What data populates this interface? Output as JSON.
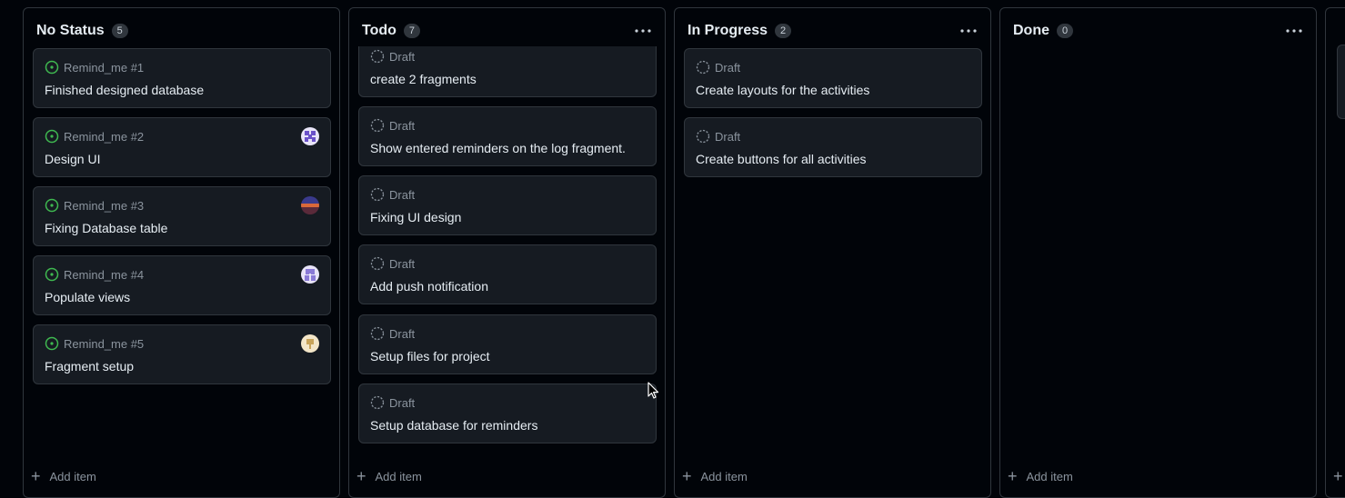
{
  "columns": [
    {
      "title": "No Status",
      "count": "5",
      "add_label": "Add item",
      "cards": [
        {
          "meta": "Remind_me #1",
          "title": "Finished designed database",
          "status_icon": "open-issue-icon",
          "avatar": null
        },
        {
          "meta": "Remind_me #2",
          "title": "Design UI",
          "status_icon": "open-issue-icon",
          "avatar": "identicon-purple"
        },
        {
          "meta": "Remind_me #3",
          "title": "Fixing Database table",
          "status_icon": "open-issue-icon",
          "avatar": "sunset-photo"
        },
        {
          "meta": "Remind_me #4",
          "title": "Populate views",
          "status_icon": "open-issue-icon",
          "avatar": "identicon-lavender"
        },
        {
          "meta": "Remind_me #5",
          "title": "Fragment setup",
          "status_icon": "open-issue-icon",
          "avatar": "identicon-tan"
        }
      ]
    },
    {
      "title": "Todo",
      "count": "7",
      "add_label": "Add item",
      "cards": [
        {
          "meta": "Draft",
          "title": "create 2 fragments",
          "status_icon": "draft-icon"
        },
        {
          "meta": "Draft",
          "title": "Show entered reminders on the log fragment.",
          "status_icon": "draft-icon"
        },
        {
          "meta": "Draft",
          "title": "Fixing UI design",
          "status_icon": "draft-icon"
        },
        {
          "meta": "Draft",
          "title": "Add push notification",
          "status_icon": "draft-icon"
        },
        {
          "meta": "Draft",
          "title": "Setup files for project",
          "status_icon": "draft-icon"
        },
        {
          "meta": "Draft",
          "title": "Setup database for reminders",
          "status_icon": "draft-icon"
        }
      ]
    },
    {
      "title": "In Progress",
      "count": "2",
      "add_label": "Add item",
      "cards": [
        {
          "meta": "Draft",
          "title": "Create layouts for the activities",
          "status_icon": "draft-icon"
        },
        {
          "meta": "Draft",
          "title": "Create buttons for all activities",
          "status_icon": "draft-icon"
        }
      ]
    },
    {
      "title": "Done",
      "count": "0",
      "add_label": "Add item",
      "cards": []
    }
  ],
  "colors": {
    "background": "#010409",
    "card": "#161b22",
    "border": "#30363d",
    "open_issue": "#3fb950",
    "muted": "#8b949e"
  }
}
